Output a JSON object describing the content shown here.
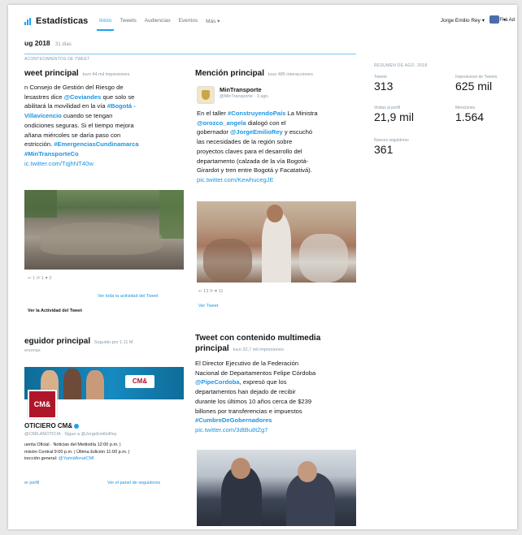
{
  "nav": {
    "brand": "Estadísticas",
    "links": [
      "Inicio",
      "Tweets",
      "Audiencias",
      "Eventos",
      "Más ▾"
    ],
    "user": "Jorge Emilio Rey ▾",
    "lang": "Fi à Ad"
  },
  "period": {
    "title": "ug 2018",
    "suffix": "31 días"
  },
  "section_tag": "ACONTECIMIENTOS DE TWEET",
  "top_tweet": {
    "title": "weet principal",
    "meta": "tuvo 44 mil impresiones",
    "lines": [
      "n Consejo de Gestión del Riesgo de",
      "lesastres dice",
      "abilitará la movilidad en la vía",
      "Villavicencio",
      "cuando se tengan",
      "ondiciones seguras. Si el tiempo mejora",
      "añana miércoles se daría paso con",
      "estricción."
    ],
    "mention1": "@Coviandes",
    "mention1_after": "que solo se",
    "hashtag1": "#Bogotá -",
    "hashtag2": "#EmergenciasCundinamarca",
    "hashtag3": "#MinTransporteCo",
    "link": "ic.twitter.com/TqjhNT40w",
    "actions": "↩ 1  ⟳ 1  ♥ 3",
    "activity_link": "Ver toda la actividad del Tweet",
    "activity_bold": "Ver la Actividad del Tweet"
  },
  "top_mention": {
    "title": "Mención principal",
    "meta": "tuvo 485 interacciones",
    "account": "MinTransporte",
    "handle": "@MinTransporte · 3 ago.",
    "p1": "En el taller",
    "h1": "#ConstruyendoPaís",
    "p2": "La Ministra",
    "m1": "@orozco_angela",
    "p3": "dialogó con el",
    "p4": "gobernador",
    "m2": "@JorgeEmilioRey",
    "p5": "y escuchó",
    "p6": "las necesidades de la región sobre",
    "p7": "proyectos claves para el desarrollo del",
    "p8": "departamento (calzada de la vía Bogotá-",
    "p9": "Girardot y tren entre Bogotá y Facatativá).",
    "link": "pic.twitter.com/KewhucegJE",
    "actions": "↩  13  ⟳  ♥ 11",
    "view": "Ver Tweet"
  },
  "top_follower": {
    "title": "eguidor principal",
    "meta": "Seguido por 1.11 M",
    "sub": "ersonas",
    "avatar": "CM&",
    "banner_logo": "CM&",
    "name": "OTICIERO CM&",
    "handle": "@CMILANOTICIA · Sigue a @JorgeEmilioRey",
    "bio1": "uenta Oficial · Noticias del Mediodía 12:00 p.m. |",
    "bio2": "misión Central 9:00 p.m. | Última Edición 11:00 p.m. |",
    "bio3": "irección general:",
    "bio3_link": "@YamidAmatCMI",
    "profile_link": "er perfil",
    "followers_link": "Ver el panel de seguidores"
  },
  "media_tweet": {
    "title1": "Tweet con contenido multimedia",
    "title2": "principal",
    "meta": "tuvo 32,7 mil impresiones",
    "p1": "El Director Ejecutivo de la Federación",
    "p2": "Nacional de Departamentos Felipe Córdoba",
    "m1": "@PipeCordoba",
    "p3": ", expresó que los",
    "p4": "departamentos han dejado de recibir",
    "p5": "durante los últimos 10 años cerca de $239",
    "p6": "billones por transferencias e impuestos",
    "h1": "#CumbreDeGobernadores",
    "link": "pic.twitter.com/3dtBu8tZg7"
  },
  "stats": {
    "title": "RESUMEN DE AGO. 2018",
    "items": [
      {
        "label": "Tweets",
        "value": "313"
      },
      {
        "label": "Impresiones de Tweets",
        "value": "625 mil"
      },
      {
        "label": "Visitas al perfil",
        "value": "21,9 mil"
      },
      {
        "label": "Menciones",
        "value": "1.564"
      },
      {
        "label": "Nuevos seguidores",
        "value": "361"
      }
    ]
  },
  "colors": {
    "accent": "#1da1f2",
    "link": "#1b95e0",
    "cm_red": "#b0162a"
  }
}
